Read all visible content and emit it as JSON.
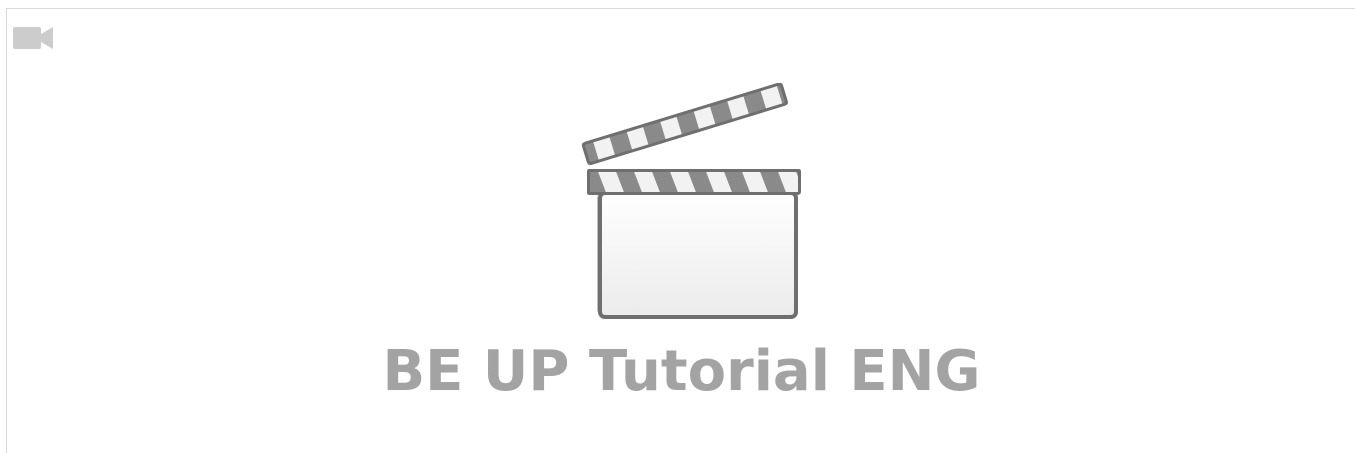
{
  "video": {
    "title": "BE UP Tutorial ENG",
    "corner_icon": "video-camera-icon",
    "placeholder_icon": "clapperboard-icon"
  },
  "colors": {
    "title_text": "#a3a3a3",
    "icon_gray": "#cccccc",
    "clapper_outline": "#6f6f6f",
    "clapper_stripe_dark": "#8a8a8a",
    "clapper_stripe_light": "#f2f2f2",
    "frame_border": "#d9d9d9"
  }
}
